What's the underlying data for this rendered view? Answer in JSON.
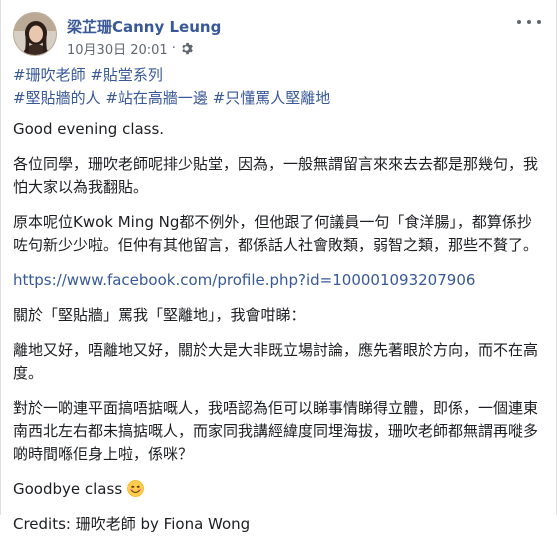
{
  "post": {
    "author": "梁芷珊Canny Leung",
    "timestamp": "10月30日 20:01",
    "separator": "·",
    "privacy_icon": "gear-icon",
    "hashtags_line1": [
      "#珊吹老師",
      "#貼堂系列"
    ],
    "hashtags_line2": [
      "#堅貼牆的人",
      "#站在高牆一邊",
      "#只懂罵人堅離地"
    ],
    "paragraphs": {
      "greeting": "Good evening class.",
      "p1": "各位同學，珊吹老師呢排少貼堂，因為，一般無謂留言來來去去都是那幾句，我怕大家以為我翻貼。",
      "p2": "原本呢位Kwok Ming Ng都不例外，但他跟了何議員一句「食洋腸」，都算係抄咗句新少少啦。佢仲有其他留言，都係話人社會敗類，弱智之類，那些不贅了。",
      "url": "https://www.facebook.com/profile.php?id=100001093207906",
      "p3": "關於「堅貼牆」罵我「堅離地」，我會咁睇：",
      "p4": "離地又好，唔離地又好，關於大是大非既立場討論，應先著眼於方向，而不在高度。",
      "p5": "對於一啲連平面搞唔掂嘅人，我唔認為佢可以睇事情睇得立體，即係，一個連東南西北左右都未搞掂嘅人，而家同我講經緯度同埋海拔，珊吹老師都無謂再嘥多啲時間喺佢身上啦，係咪？",
      "goodbye": "Goodbye class",
      "credits": "Credits: 珊吹老師 by Fiona Wong"
    },
    "emoji_icon": "smiling-face-icon"
  }
}
